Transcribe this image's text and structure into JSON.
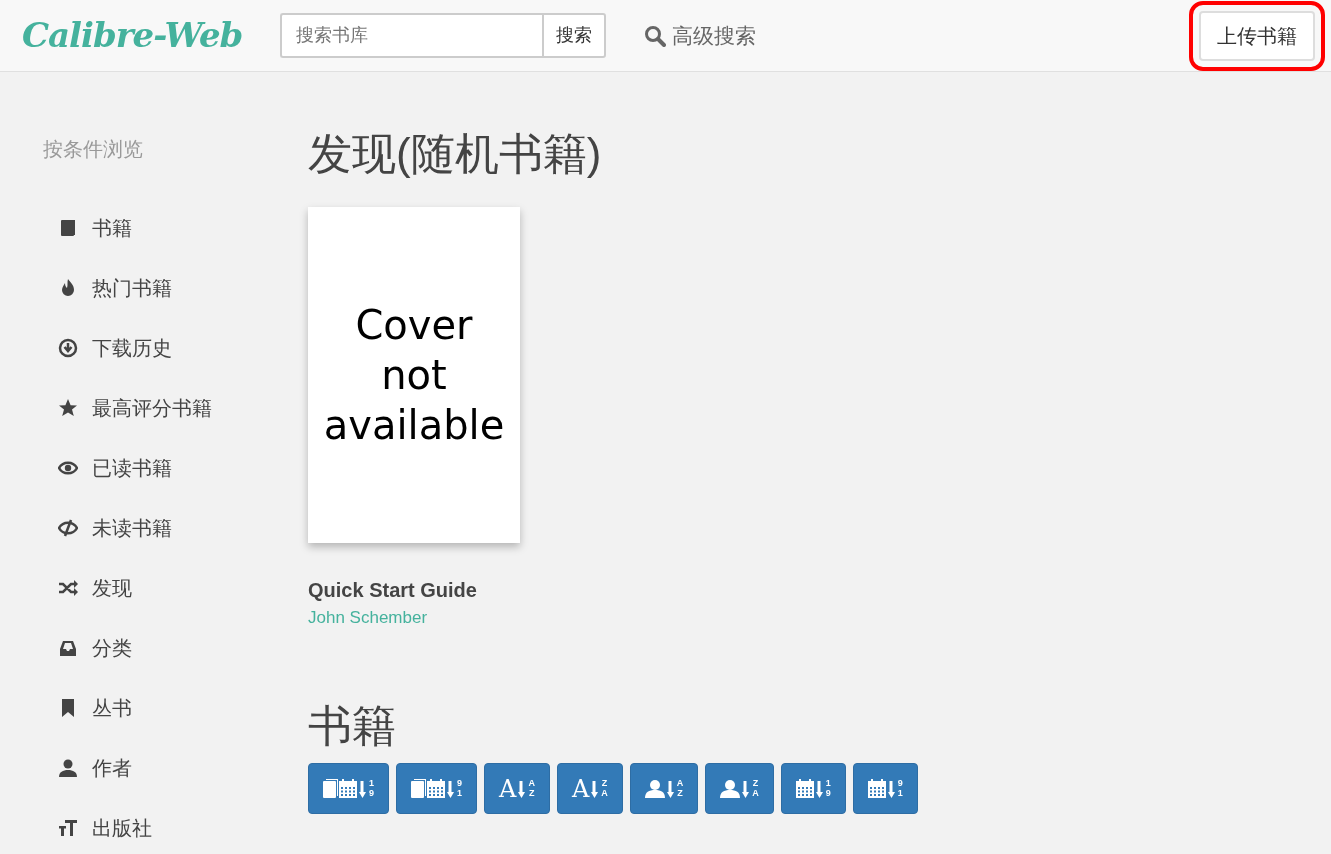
{
  "navbar": {
    "logo": "Calibre-Web",
    "search": {
      "placeholder": "搜索书库",
      "button": "搜索"
    },
    "advanced_search": "高级搜索",
    "upload_button": {
      "label": "上传书籍",
      "highlighted": true
    }
  },
  "sidebar": {
    "heading": "按条件浏览",
    "items": [
      {
        "label": "书籍",
        "kind": "book"
      },
      {
        "label": "热门书籍",
        "kind": "fire"
      },
      {
        "label": "下载历史",
        "kind": "download"
      },
      {
        "label": "最高评分书籍",
        "kind": "star"
      },
      {
        "label": "已读书籍",
        "kind": "eye"
      },
      {
        "label": "未读书籍",
        "kind": "eye-slash"
      },
      {
        "label": "发现",
        "kind": "shuffle"
      },
      {
        "label": "分类",
        "kind": "inbox"
      },
      {
        "label": "丛书",
        "kind": "bookmark"
      },
      {
        "label": "作者",
        "kind": "user"
      },
      {
        "label": "出版社",
        "kind": "text"
      }
    ]
  },
  "discover": {
    "title": "发现(随机书籍)",
    "books": [
      {
        "cover_text": "Cover not available",
        "title": "Quick Start Guide",
        "author": "John Schember"
      }
    ]
  },
  "books": {
    "title": "书籍",
    "sort_buttons": [
      {
        "kind": "book-date",
        "marks": [
          "1",
          "9"
        ]
      },
      {
        "kind": "book-date",
        "marks": [
          "9",
          "1"
        ]
      },
      {
        "kind": "letter",
        "glyph": "A",
        "marks": [
          "A",
          "Z"
        ]
      },
      {
        "kind": "letter",
        "glyph": "A",
        "marks": [
          "Z",
          "A"
        ]
      },
      {
        "kind": "user",
        "marks": [
          "A",
          "Z"
        ]
      },
      {
        "kind": "user",
        "marks": [
          "Z",
          "A"
        ]
      },
      {
        "kind": "date",
        "marks": [
          "1",
          "9"
        ]
      },
      {
        "kind": "date",
        "marks": [
          "9",
          "1"
        ]
      }
    ]
  }
}
